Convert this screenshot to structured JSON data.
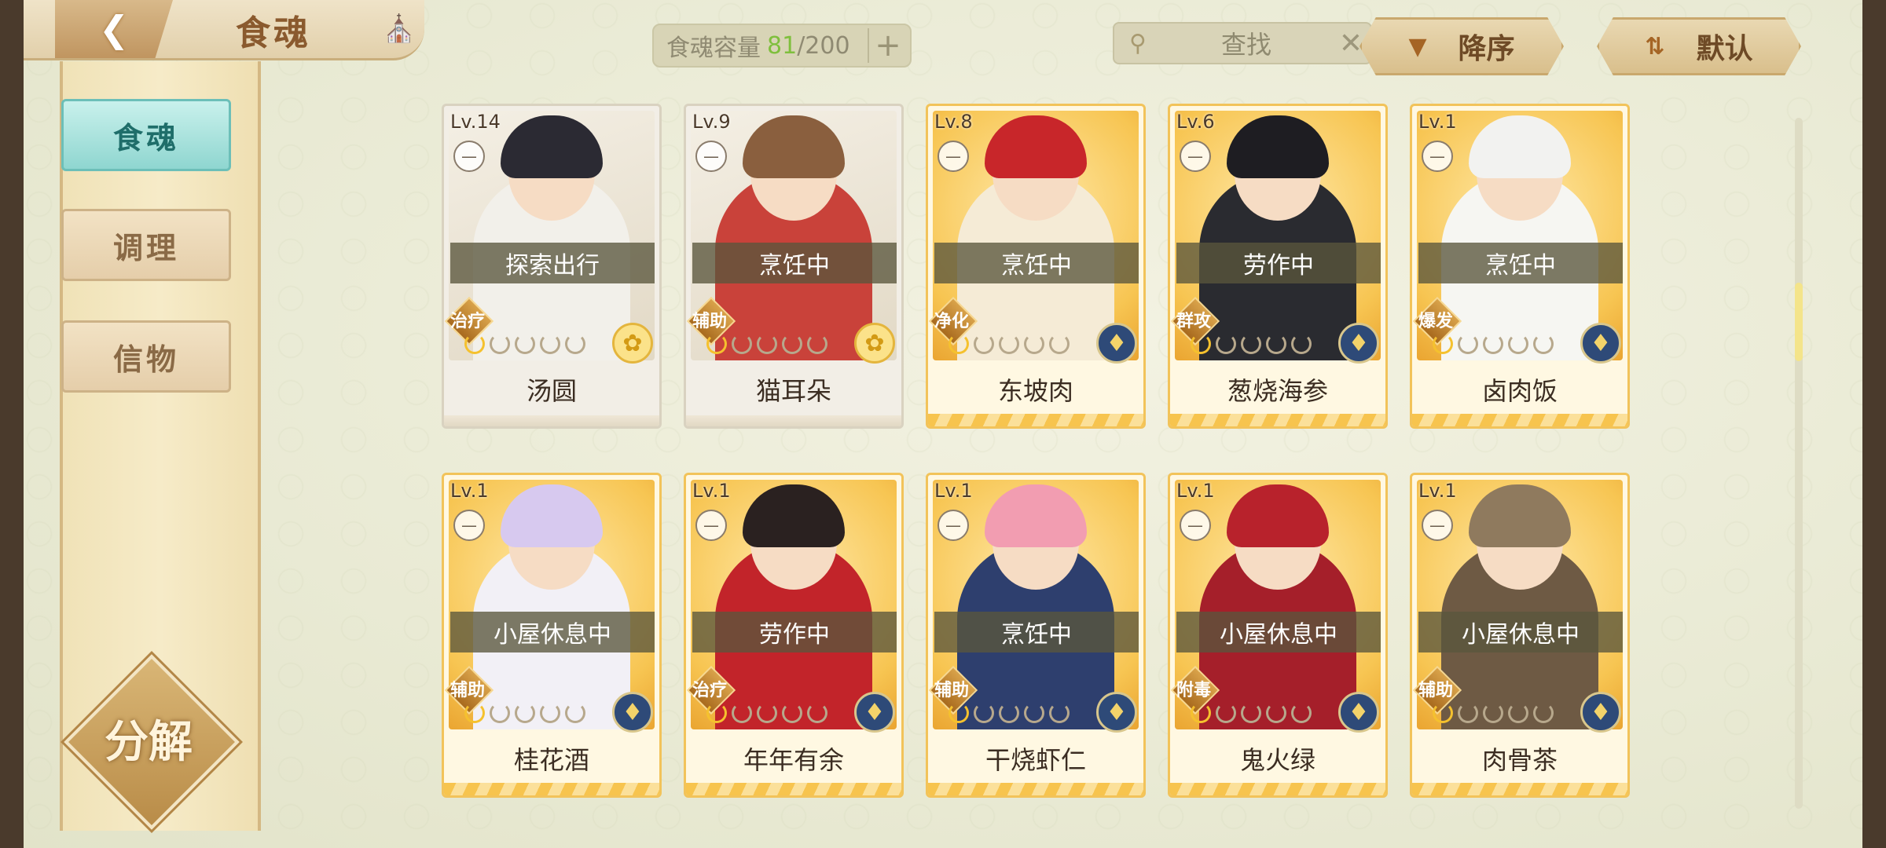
{
  "header": {
    "back_icon": "back-arrow-icon",
    "title": "食魂",
    "home_icon": "pavilion-icon",
    "capacity": {
      "label": "食魂容量",
      "current": "81",
      "max": "/200",
      "plus": "+"
    },
    "search": {
      "placeholder": "查找",
      "clear": "✕"
    },
    "sort_order": "降序",
    "sort_mode": "默认"
  },
  "sidebar": {
    "items": [
      {
        "label": "食魂",
        "active": true
      },
      {
        "label": "调理",
        "active": false
      },
      {
        "label": "信物",
        "active": false
      }
    ],
    "decompose": "分解"
  },
  "cards": [
    {
      "level": "Lv.14",
      "status": "探索出行",
      "role": "治疗",
      "name": "汤圆",
      "stars_lit": 1,
      "emblem": "yellow",
      "frame": "gray",
      "hair": "#2b2a33",
      "outfit": "#f2f0ea"
    },
    {
      "level": "Lv.9",
      "status": "烹饪中",
      "role": "辅助",
      "name": "猫耳朵",
      "stars_lit": 1,
      "emblem": "yellow",
      "frame": "gray",
      "hair": "#8a5f3e",
      "outfit": "#c9423a"
    },
    {
      "level": "Lv.8",
      "status": "烹饪中",
      "role": "净化",
      "name": "东坡肉",
      "stars_lit": 1,
      "emblem": "blue",
      "frame": "gold",
      "hair": "#c8262a",
      "outfit": "#f5ebd6"
    },
    {
      "level": "Lv.6",
      "status": "劳作中",
      "role": "群攻",
      "name": "葱烧海参",
      "stars_lit": 1,
      "emblem": "blue",
      "frame": "gold",
      "hair": "#1e1d22",
      "outfit": "#2a2b30"
    },
    {
      "level": "Lv.1",
      "status": "烹饪中",
      "role": "爆发",
      "name": "卤肉饭",
      "stars_lit": 1,
      "emblem": "blue",
      "frame": "gold",
      "hair": "#f2f2f0",
      "outfit": "#f6f6f2"
    },
    {
      "level": "Lv.1",
      "status": "小屋休息中",
      "role": "辅助",
      "name": "桂花酒",
      "stars_lit": 1,
      "emblem": "blue",
      "frame": "gold",
      "hair": "#d7c9ef",
      "outfit": "#f2f0f6"
    },
    {
      "level": "Lv.1",
      "status": "劳作中",
      "role": "治疗",
      "name": "年年有余",
      "stars_lit": 1,
      "emblem": "blue",
      "frame": "gold",
      "hair": "#2a2120",
      "outfit": "#c2242a"
    },
    {
      "level": "Lv.1",
      "status": "烹饪中",
      "role": "辅助",
      "name": "干烧虾仁",
      "stars_lit": 1,
      "emblem": "blue",
      "frame": "gold",
      "hair": "#f29db1",
      "outfit": "#2e3f6e"
    },
    {
      "level": "Lv.1",
      "status": "小屋休息中",
      "role": "附毒",
      "name": "鬼火绿",
      "stars_lit": 1,
      "emblem": "blue",
      "frame": "gold",
      "hair": "#b8222c",
      "outfit": "#a51f2a"
    },
    {
      "level": "Lv.1",
      "status": "小屋休息中",
      "role": "辅助",
      "name": "肉骨茶",
      "stars_lit": 1,
      "emblem": "blue",
      "frame": "gold",
      "hair": "#8f7a5e",
      "outfit": "#6e5a44"
    }
  ],
  "colors": {
    "accent_teal": "#8fd6d0",
    "gold": "#f2c35a",
    "capacity_green": "#7fbf3d"
  }
}
